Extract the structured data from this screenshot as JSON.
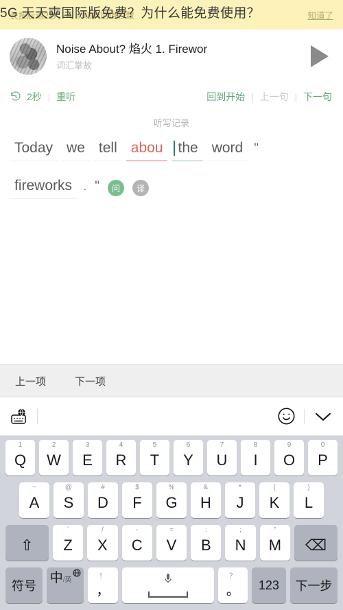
{
  "watermark": {
    "text": "5G 天天奭国际版免费？为什么能免费使用？"
  },
  "tip_banner": {
    "text": "长按后退2秒，可以切换后退秒数",
    "action_label": "知道了",
    "background": "#fdf3ba",
    "text_color": "#b9a96a"
  },
  "player": {
    "title": "Noise About? 焰火    1. Firewor",
    "subtitle": "词汇掌故",
    "play_button_label": "play",
    "cover_alt": "album-art"
  },
  "controls": {
    "rewind_seconds": "2秒",
    "replay_label": "重听",
    "restart_label": "回到开始",
    "prev_sentence_label": "上一句",
    "next_sentence_label": "下一句",
    "separator": "|",
    "accent_color": "#6aab7a",
    "muted_color": "#c9c9c9"
  },
  "dictation": {
    "header": "听写记录",
    "line1": [
      {
        "text": "Today",
        "state": "normal"
      },
      {
        "text": "we",
        "state": "normal"
      },
      {
        "text": "tell",
        "state": "normal"
      },
      {
        "text": "abou",
        "state": "wrong"
      },
      {
        "text": "the",
        "state": "active"
      },
      {
        "text": "word",
        "state": "normal"
      },
      {
        "text": "\"",
        "state": "punct"
      }
    ],
    "line2": [
      {
        "text": "fireworks",
        "state": "normal"
      },
      {
        "text": ".",
        "state": "dot"
      },
      {
        "text": "\"",
        "state": "punct"
      }
    ],
    "badges": [
      {
        "label": "问",
        "kind": "ask",
        "color": "#7cbd8e"
      },
      {
        "label": "译",
        "kind": "translate",
        "color": "#b4b4b4"
      }
    ],
    "wrong_color": "#d9675f",
    "caret_color": "#2e7d5b"
  },
  "item_nav": {
    "prev_label": "上一项",
    "next_label": "下一项"
  },
  "keyboard_toolbar": {
    "switch_icon": "globe-keyboard-icon",
    "emoji_icon": "smiley-icon",
    "dismiss_icon": "chevron-down-icon"
  },
  "keyboard": {
    "row1": [
      {
        "key": "Q",
        "hint": "1"
      },
      {
        "key": "W",
        "hint": "2"
      },
      {
        "key": "E",
        "hint": "3"
      },
      {
        "key": "R",
        "hint": "4"
      },
      {
        "key": "T",
        "hint": "5"
      },
      {
        "key": "Y",
        "hint": "6"
      },
      {
        "key": "U",
        "hint": "7"
      },
      {
        "key": "I",
        "hint": "8"
      },
      {
        "key": "O",
        "hint": "9"
      },
      {
        "key": "P",
        "hint": "0"
      }
    ],
    "row2": [
      {
        "key": "A",
        "hint": "~"
      },
      {
        "key": "S",
        "hint": "@"
      },
      {
        "key": "D",
        "hint": "#"
      },
      {
        "key": "F",
        "hint": "$"
      },
      {
        "key": "G",
        "hint": "%"
      },
      {
        "key": "H",
        "hint": "&"
      },
      {
        "key": "J",
        "hint": "*"
      },
      {
        "key": "K",
        "hint": "("
      },
      {
        "key": "L",
        "hint": ")"
      }
    ],
    "row3": {
      "shift_label": "⇧",
      "keys": [
        {
          "key": "Z",
          "hint": "`"
        },
        {
          "key": "X",
          "hint": "/"
        },
        {
          "key": "C",
          "hint": "-"
        },
        {
          "key": "V",
          "hint": "="
        },
        {
          "key": "B",
          "hint": ":"
        },
        {
          "key": "N",
          "hint": ";"
        },
        {
          "key": "M",
          "hint": "\""
        }
      ],
      "backspace_label": "⌫"
    },
    "row4": {
      "symbol_label": "符号",
      "lang_main": "中",
      "lang_sub": "/英",
      "comma_top": "！",
      "comma_bottom": "，",
      "space_label": "",
      "period_top": "？",
      "period_bottom": "。",
      "numeric_label": "123",
      "next_label": "下一步"
    }
  }
}
